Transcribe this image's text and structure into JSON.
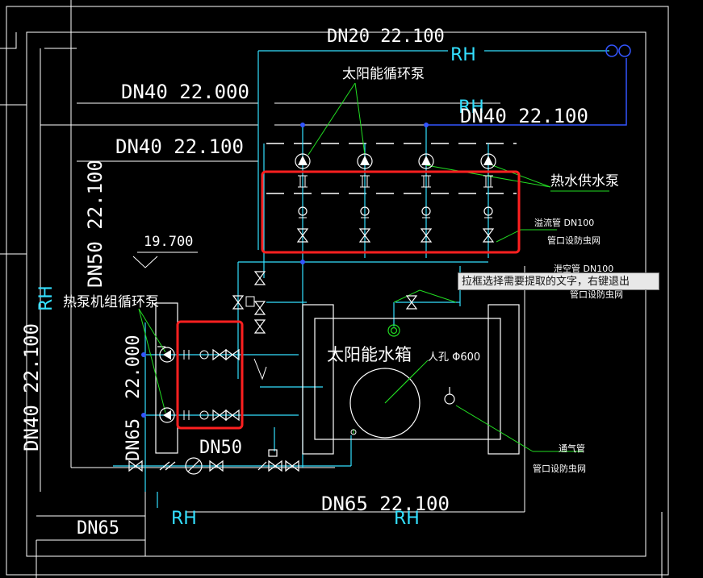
{
  "labels": {
    "dn20_22100": "DN20  22.100",
    "rh_top": "RH",
    "solar_pump": "太阳能循环泵",
    "dn40_22000": "DN40  22.000",
    "rh_mid": "RH",
    "dn40_22100_right": "DN40  22.100",
    "dn40_22100_left": "DN40  22.100",
    "hot_water_pump": "热水供水泵",
    "overflow_pipe": "溢流管 DN100",
    "overflow_note": "管口设防虫网",
    "drain_pipe": "泄空管 DN100",
    "drain_note": "管口设防虫网",
    "elev_19700": "19.700",
    "dn50_22100": "DN50  22.100",
    "rh_left": "RH",
    "heat_pump_unit": "热泵机组循环泵",
    "solar_tank": "太阳能水箱",
    "manhole": "人孔 Φ600",
    "v_22000": "22.000",
    "dn40_22100_vertical": "DN40  22.100",
    "dn65_left": "DN65",
    "dn50_bottom": "DN50",
    "vent_pipe": "通气管",
    "vent_note": "管口设防虫网",
    "dn65_22100": "DN65  22.100",
    "rh_bottom_left": "RH",
    "rh_bottom_right": "RH",
    "dn65_bottom": "DN65"
  },
  "tooltip": "拉框选择需要提取的文字，右键退出",
  "colors": {
    "background": "#000000",
    "line_white": "#ffffff",
    "pipe_cyan": "#33e0ff",
    "leader_green": "#22dd22",
    "highlight_red": "#ff2020",
    "node_blue": "#3355ff"
  }
}
